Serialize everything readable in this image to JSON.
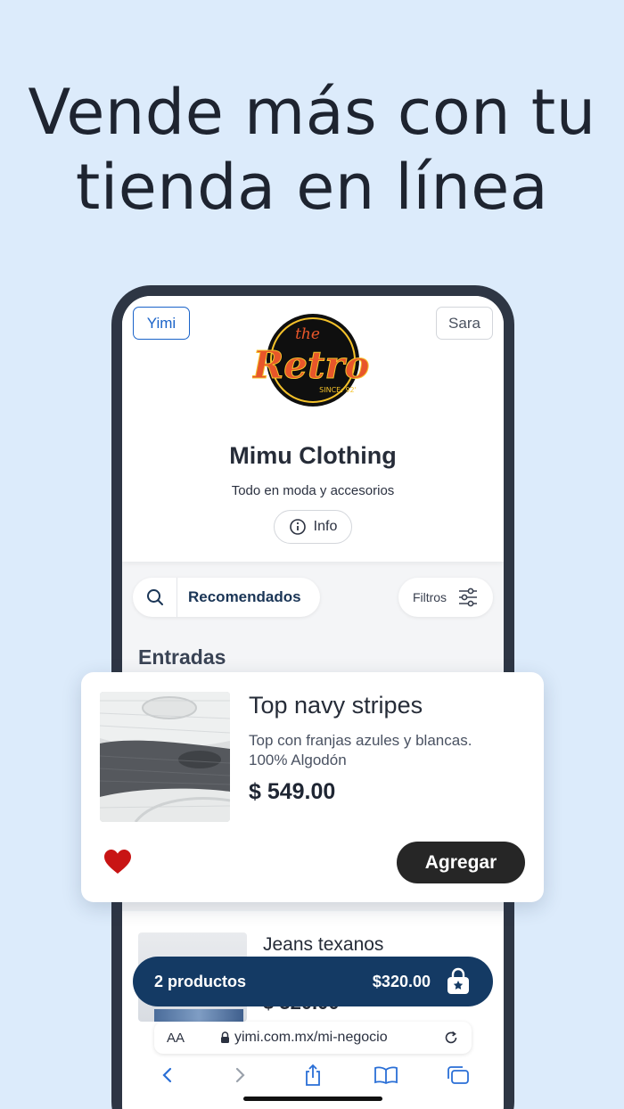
{
  "headline": {
    "line1": "Vende más con tu",
    "line2": "tienda en línea"
  },
  "store": {
    "left_button": "Yimi",
    "right_button": "Sara",
    "logo_text_top": "the",
    "logo_text_main": "Retro",
    "logo_text_since": "SINCE: 92'",
    "name": "Mimu Clothing",
    "description": "Todo en moda y accesorios",
    "info_label": "Info"
  },
  "toolbar": {
    "category_label": "Recomendados",
    "filters_label": "Filtros"
  },
  "section_title": "Entradas",
  "featured_product": {
    "title": "Top navy stripes",
    "description_line1": "Top con franjas azules y blancas.",
    "description_line2": "100% Algodón",
    "price": "$ 549.00",
    "add_label": "Agregar",
    "favorited": true
  },
  "second_product": {
    "title": "Jeans texanos",
    "price": "$ 320.00"
  },
  "cart": {
    "count_label": "2 productos",
    "total": "$320.00"
  },
  "browser": {
    "text_size_label": "AA",
    "url": "yimi.com.mx/mi-negocio"
  },
  "colors": {
    "background": "#dcebfb",
    "cart_bar": "#143a64",
    "accent_blue": "#1a63c9",
    "heart": "#c81414",
    "logo_orange": "#e8562a",
    "logo_yellow": "#f5c22a"
  }
}
